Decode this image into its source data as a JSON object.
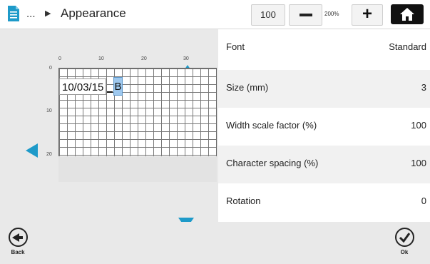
{
  "header": {
    "breadcrumb_ellipsis": "...",
    "breadcrumb_separator": "▶",
    "title": "Appearance",
    "zoom_value": "100",
    "zoom_max_label": "200%",
    "zoom_plus_label": "+"
  },
  "ruler": {
    "x_ticks": [
      "0",
      "10",
      "20",
      "30"
    ],
    "y_ticks": [
      "0",
      "10",
      "20"
    ]
  },
  "editor": {
    "text": "10/03/15",
    "cursor_char": "B"
  },
  "properties": [
    {
      "label": "Font",
      "value": "Standard"
    },
    {
      "label": "Size (mm)",
      "value": "3"
    },
    {
      "label": "Width scale factor (%)",
      "value": "100"
    },
    {
      "label": "Character spacing (%)",
      "value": "100"
    },
    {
      "label": "Rotation",
      "value": "0"
    }
  ],
  "footer": {
    "back_label": "Back",
    "ok_label": "Ok"
  },
  "colors": {
    "accent_arrows": "#1e9ac9",
    "doc_icon": "#1e9ac9",
    "cursor_highlight": "#9ec8ee",
    "home_button": "#111111"
  },
  "icons": {
    "doc": "document-icon",
    "home": "home-icon",
    "back": "back-arrow-icon",
    "ok": "check-icon"
  }
}
